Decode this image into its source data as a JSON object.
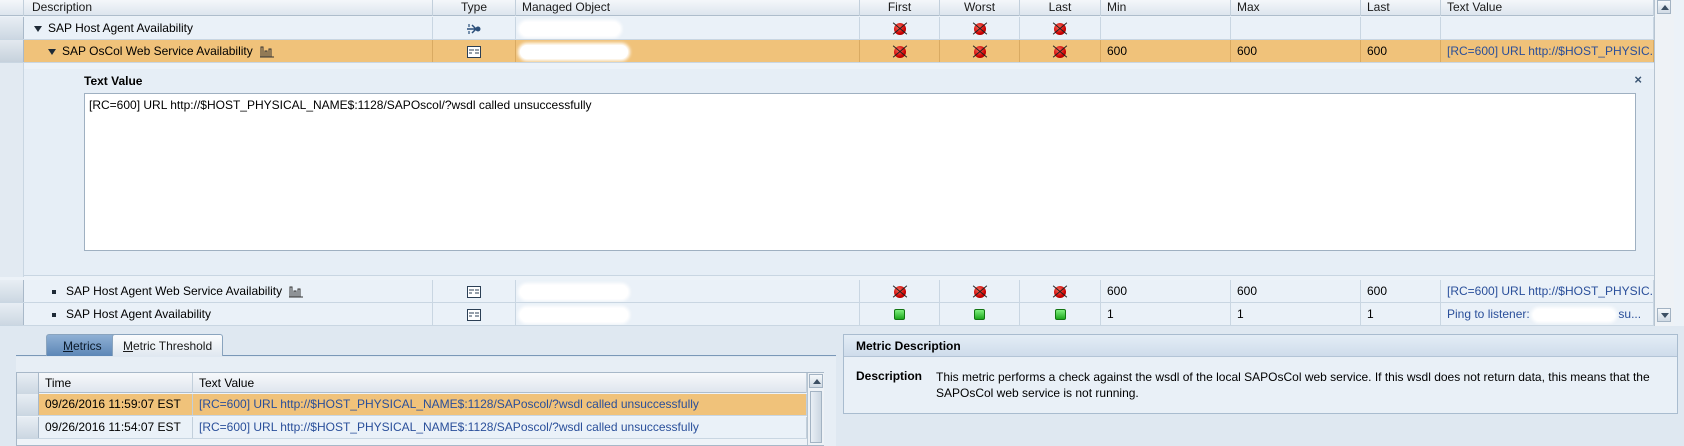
{
  "tree": {
    "columns": {
      "description": "Description",
      "type": "Type",
      "managed_object": "Managed Object",
      "first": "First",
      "worst": "Worst",
      "last": "Last",
      "min": "Min",
      "max": "Max",
      "last2": "Last",
      "text_value": "Text Value"
    },
    "rows": [
      {
        "label": "SAP Host Agent Availability",
        "type_icon": "aggregate-flow-icon",
        "first": "red",
        "worst": "red",
        "last": "red",
        "min": "",
        "max": "",
        "last2": "",
        "text_value": ""
      },
      {
        "label": "SAP OsCol Web Service Availability",
        "type_icon": "metric-icon",
        "first": "red",
        "worst": "red",
        "last": "red",
        "min": "600",
        "max": "600",
        "last2": "600",
        "text_value": "[RC=600] URL http://$HOST_PHYSIC..."
      },
      {
        "label": "SAP Host Agent Web Service Availability",
        "type_icon": "metric-icon",
        "first": "red",
        "worst": "red",
        "last": "red",
        "min": "600",
        "max": "600",
        "last2": "600",
        "text_value": "[RC=600] URL http://$HOST_PHYSIC..."
      },
      {
        "label": "SAP Host Agent Availability",
        "type_icon": "metric-icon",
        "first": "green",
        "worst": "green",
        "last": "green",
        "min": "1",
        "max": "1",
        "last2": "1",
        "text_value_prefix": "Ping to listener:",
        "text_value_suffix": "su..."
      }
    ]
  },
  "detail": {
    "title": "Text Value",
    "close": "×",
    "text": "[RC=600] URL http://$HOST_PHYSICAL_NAME$:1128/SAPOscol/?wsdl called unsuccessfully"
  },
  "tabs": {
    "metrics": "Metrics",
    "metrics_key": "M",
    "metrics_rest": "etrics",
    "threshold": "Metric Threshold",
    "threshold_key": "M",
    "threshold_rest": "etric Threshold"
  },
  "metrics_table": {
    "columns": {
      "time": "Time",
      "text_value": "Text Value"
    },
    "rows": [
      {
        "time": "09/26/2016 11:59:07 EST",
        "text": "[RC=600] URL http://$HOST_PHYSICAL_NAME$:1128/SAPoscol/?wsdl called unsuccessfully"
      },
      {
        "time": "09/26/2016 11:54:07 EST",
        "text": "[RC=600] URL http://$HOST_PHYSICAL_NAME$:1128/SAPoscol/?wsdl called unsuccessfully"
      }
    ]
  },
  "metric_description": {
    "title": "Metric Description",
    "label": "Description",
    "text": "This metric performs a check against the wsdl of the local SAPOsCol web service. If this wsdl does not return data, this means that the SAPOsCol web service is not running."
  },
  "colors": {
    "selected_row": "#f0c27a",
    "link": "#2a4f9a",
    "status_red": "#cc0000",
    "status_green": "#1da81d"
  }
}
